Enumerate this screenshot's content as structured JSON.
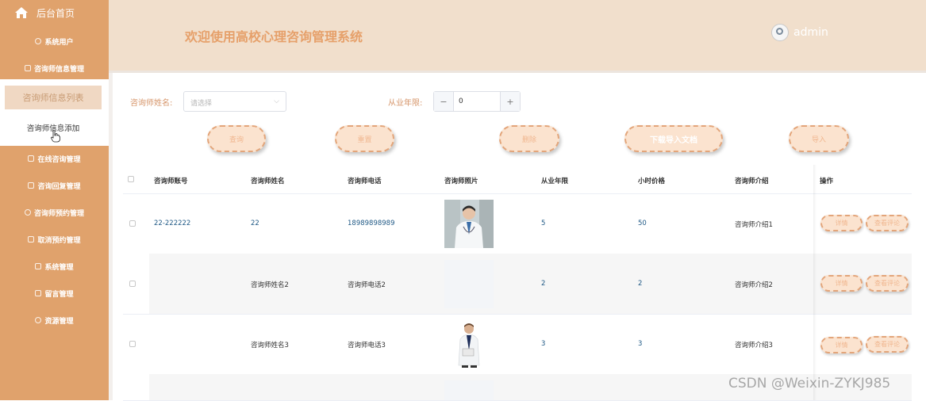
{
  "sidebar": {
    "home_label": "后台首页",
    "items_top": [
      "系统用户",
      "咨询师信息管理"
    ],
    "submenu": {
      "active_label": "咨询师信息列表",
      "add_label": "咨询师信息添加"
    },
    "items_bottom": [
      "在线咨询管理",
      "咨询回复管理",
      "咨询师预约管理",
      "取消预约管理",
      "系统管理",
      "留言管理",
      "资源管理"
    ]
  },
  "header": {
    "title": "欢迎使用高校心理咨询管理系统",
    "username": "admin"
  },
  "filters": {
    "name_label": "咨询师姓名:",
    "name_placeholder": "请选择",
    "years_label": "从业年限:",
    "years_value": "0",
    "minus": "−",
    "plus": "+"
  },
  "buttons": {
    "search": "查询",
    "reset": "重置",
    "delete": "删除",
    "download": "下载导入文档",
    "import": "导入"
  },
  "table": {
    "columns": [
      "咨询师账号",
      "咨询师姓名",
      "咨询师电话",
      "咨询师照片",
      "从业年限",
      "小时价格",
      "咨询师介绍",
      "操作"
    ],
    "rows": [
      {
        "account": "22-222222",
        "name": "22",
        "phone": "18989898989",
        "photo": "doctor-photo",
        "years": "5",
        "price": "50",
        "intro": "咨询师介绍1"
      },
      {
        "account": "",
        "name": "咨询师姓名2",
        "phone": "咨询师电话2",
        "photo": "",
        "years": "2",
        "price": "2",
        "intro": "咨询师介绍2"
      },
      {
        "account": "",
        "name": "咨询师姓名3",
        "phone": "咨询师电话3",
        "photo": "doctor-photo",
        "years": "3",
        "price": "3",
        "intro": "咨询师介绍3"
      }
    ],
    "op_detail": "详情",
    "op_comments": "查看评论"
  },
  "watermark": "CSDN @Weixin-ZYKJ985",
  "colors": {
    "sidebar": "#e0a26c",
    "header": "#f1dfcc",
    "accent": "#e6a06a"
  }
}
